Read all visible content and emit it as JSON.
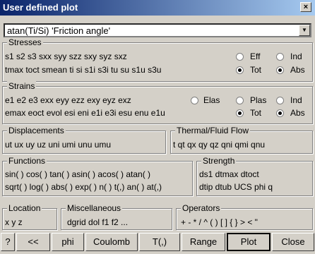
{
  "window": {
    "title": "User defined plot",
    "close_glyph": "×"
  },
  "combo": {
    "value": "atan(Ti/Si) 'Friction angle'",
    "arrow": "▼"
  },
  "stresses": {
    "legend": "Stresses",
    "line1": "s1 s2 s3   sxx syy szz sxy syz sxz",
    "line2": "tmax toct smean   ti si s1i s3i   tu su s1u s3u",
    "radios": [
      {
        "label": "Eff",
        "checked": false
      },
      {
        "label": "Ind",
        "checked": false
      },
      {
        "label": "Tot",
        "checked": true
      },
      {
        "label": "Abs",
        "checked": true
      }
    ]
  },
  "strains": {
    "legend": "Strains",
    "line1": "e1 e2 e3   exx eyy ezz exy eyz exz",
    "line2": "emax eoct evol   esi eni e1i e3i   esu enu e1u",
    "radios": [
      {
        "label": "Elas",
        "checked": false
      },
      {
        "label": "Plas",
        "checked": false
      },
      {
        "label": "Ind",
        "checked": false
      },
      {
        "label": "Tot",
        "checked": true
      },
      {
        "label": "Abs",
        "checked": true
      }
    ]
  },
  "displacements": {
    "legend": "Displacements",
    "line1": "ut ux uy uz    uni umi unu umu"
  },
  "thermal": {
    "legend": "Thermal/Fluid Flow",
    "line1": "t  qt qx qy qz   qni qmi qnu"
  },
  "functions": {
    "legend": "Functions",
    "line1": "sin( ) cos( ) tan( ) asin( ) acos( ) atan( )",
    "line2": "sqrt( ) log( ) abs( ) exp( ) n( ) t(,) an( ) at(,)"
  },
  "strength": {
    "legend": "Strength",
    "line1": "ds1 dtmax dtoct",
    "line2": "dtip dtub UCS phi q"
  },
  "location": {
    "legend": "Location",
    "line1": "x y z"
  },
  "misc": {
    "legend": "Miscellaneous",
    "line1": "dgrid dol   f1 f2 ..."
  },
  "operators": {
    "legend": "Operators",
    "line1": "+ - * / ^  ( )  [ ]  { }   > <   \""
  },
  "buttons": [
    {
      "label": "?"
    },
    {
      "label": "<<"
    },
    {
      "label": "phi"
    },
    {
      "label": "Coulomb"
    },
    {
      "label": "T(,)"
    },
    {
      "label": "Range"
    },
    {
      "label": "Plot"
    },
    {
      "label": "Close"
    }
  ],
  "colors": {
    "title_start": "#0a246a",
    "title_end": "#a6caf0",
    "face": "#d4d0c8"
  }
}
